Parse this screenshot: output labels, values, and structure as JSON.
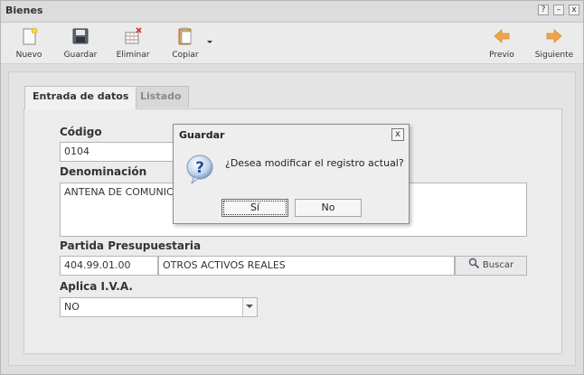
{
  "window": {
    "title": "Bienes"
  },
  "window_buttons": {
    "help": "?",
    "minimize": "–",
    "close": "x"
  },
  "toolbar": {
    "nuevo": "Nuevo",
    "guardar": "Guardar",
    "eliminar": "Eliminar",
    "copiar": "Copiar",
    "previo": "Previo",
    "siguiente": "Siguiente"
  },
  "tabs": {
    "entrada": "Entrada de datos",
    "listado": "Listado"
  },
  "form": {
    "codigo_label": "Código",
    "codigo_value": "0104",
    "denominacion_label": "Denominación",
    "denominacion_value": "ANTENA DE COMUNICACION",
    "partida_label": "Partida Presupuestaria",
    "partida_code": "404.99.01.00",
    "partida_desc": "OTROS ACTIVOS REALES",
    "buscar_label": "Buscar",
    "iva_label": "Aplica I.V.A.",
    "iva_value": "NO"
  },
  "dialog": {
    "title": "Guardar",
    "close": "x",
    "message": "¿Desea modificar el registro actual?",
    "yes": "Sí",
    "no": "No"
  }
}
